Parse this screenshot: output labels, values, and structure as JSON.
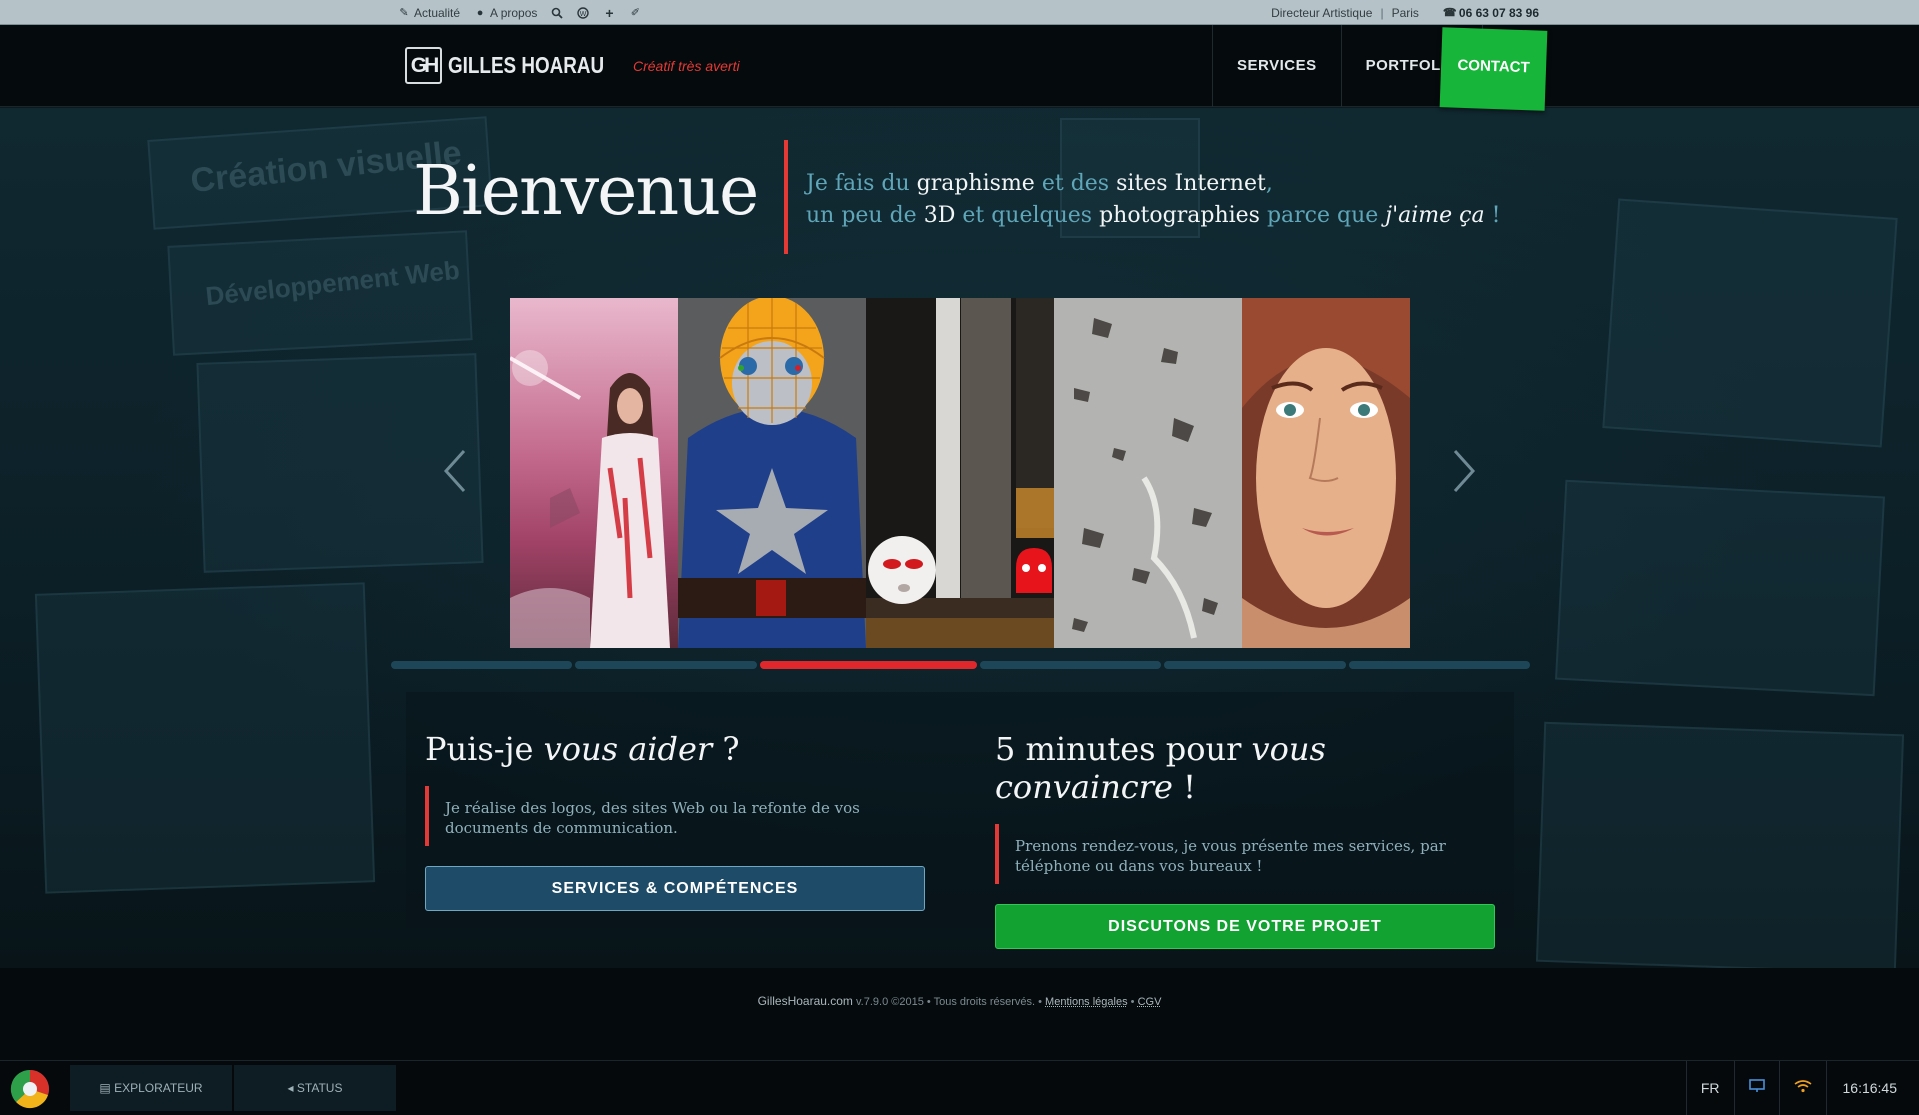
{
  "topbar": {
    "news": "Actualité",
    "about": "A propos",
    "role": "Directeur Artistique",
    "sep": "|",
    "city": "Paris",
    "phone": "06 63 07 83 96"
  },
  "header": {
    "logo_mark": "GH",
    "logo_name": "GILLES HOARAU",
    "tagline": "Créatif très averti",
    "nav": {
      "services": "SERVICES",
      "portfolio": "PORTFOLIO",
      "contact": "CONTACT"
    }
  },
  "hero": {
    "title": "Bienvenue",
    "intro": {
      "p1": "Je fais du ",
      "w1": "graphisme",
      "p2": " et des ",
      "w2": "sites Internet",
      "p3": ",",
      "p4": "un peu de ",
      "w3": "3D",
      "p5": " et quelques ",
      "w4": "photographies",
      "p6": " parce que ",
      "w5": "j'aime ça",
      "p7": " !"
    },
    "bg_words": [
      "Création visuelle",
      "Développement Web"
    ]
  },
  "slider": {
    "slides": [
      "slide-fantasy-woman",
      "slide-3d-superhero",
      "slide-3d-ghosts",
      "slide-wall-texture",
      "slide-portrait-woman"
    ],
    "dots": 6,
    "active_dot": 2
  },
  "callouts": {
    "left": {
      "title_plain": "Puis-je ",
      "title_em": "vous aider",
      "title_end": " ?",
      "desc": "Je réalise des logos, des sites Web ou la refonte de vos documents de communication.",
      "button": "SERVICES & COMPÉTENCES"
    },
    "right": {
      "title_plain": "5 minutes pour ",
      "title_em": "vous convaincre",
      "title_end": " !",
      "desc": "Prenons rendez-vous, je vous présente mes services, par téléphone ou dans vos bureaux !",
      "button_plain": "DISCUTONS DE ",
      "button_bold": "VOTRE PROJET"
    }
  },
  "footer": {
    "site": "GillesHoarau.com",
    "meta": " v.7.9.0 ©2015 • Tous droits réservés. • ",
    "legal": "Mentions légales",
    "dot": " • ",
    "cgv": "CGV"
  },
  "taskbar": {
    "explorer": "EXPLORATEUR",
    "status": "STATUS",
    "lang": "FR",
    "clock": "16:16:45"
  },
  "colors": {
    "accent_red": "#e53935",
    "contact_green": "#17b53a",
    "cta_blue": "#1e4b67",
    "cta_green": "#12a232"
  }
}
